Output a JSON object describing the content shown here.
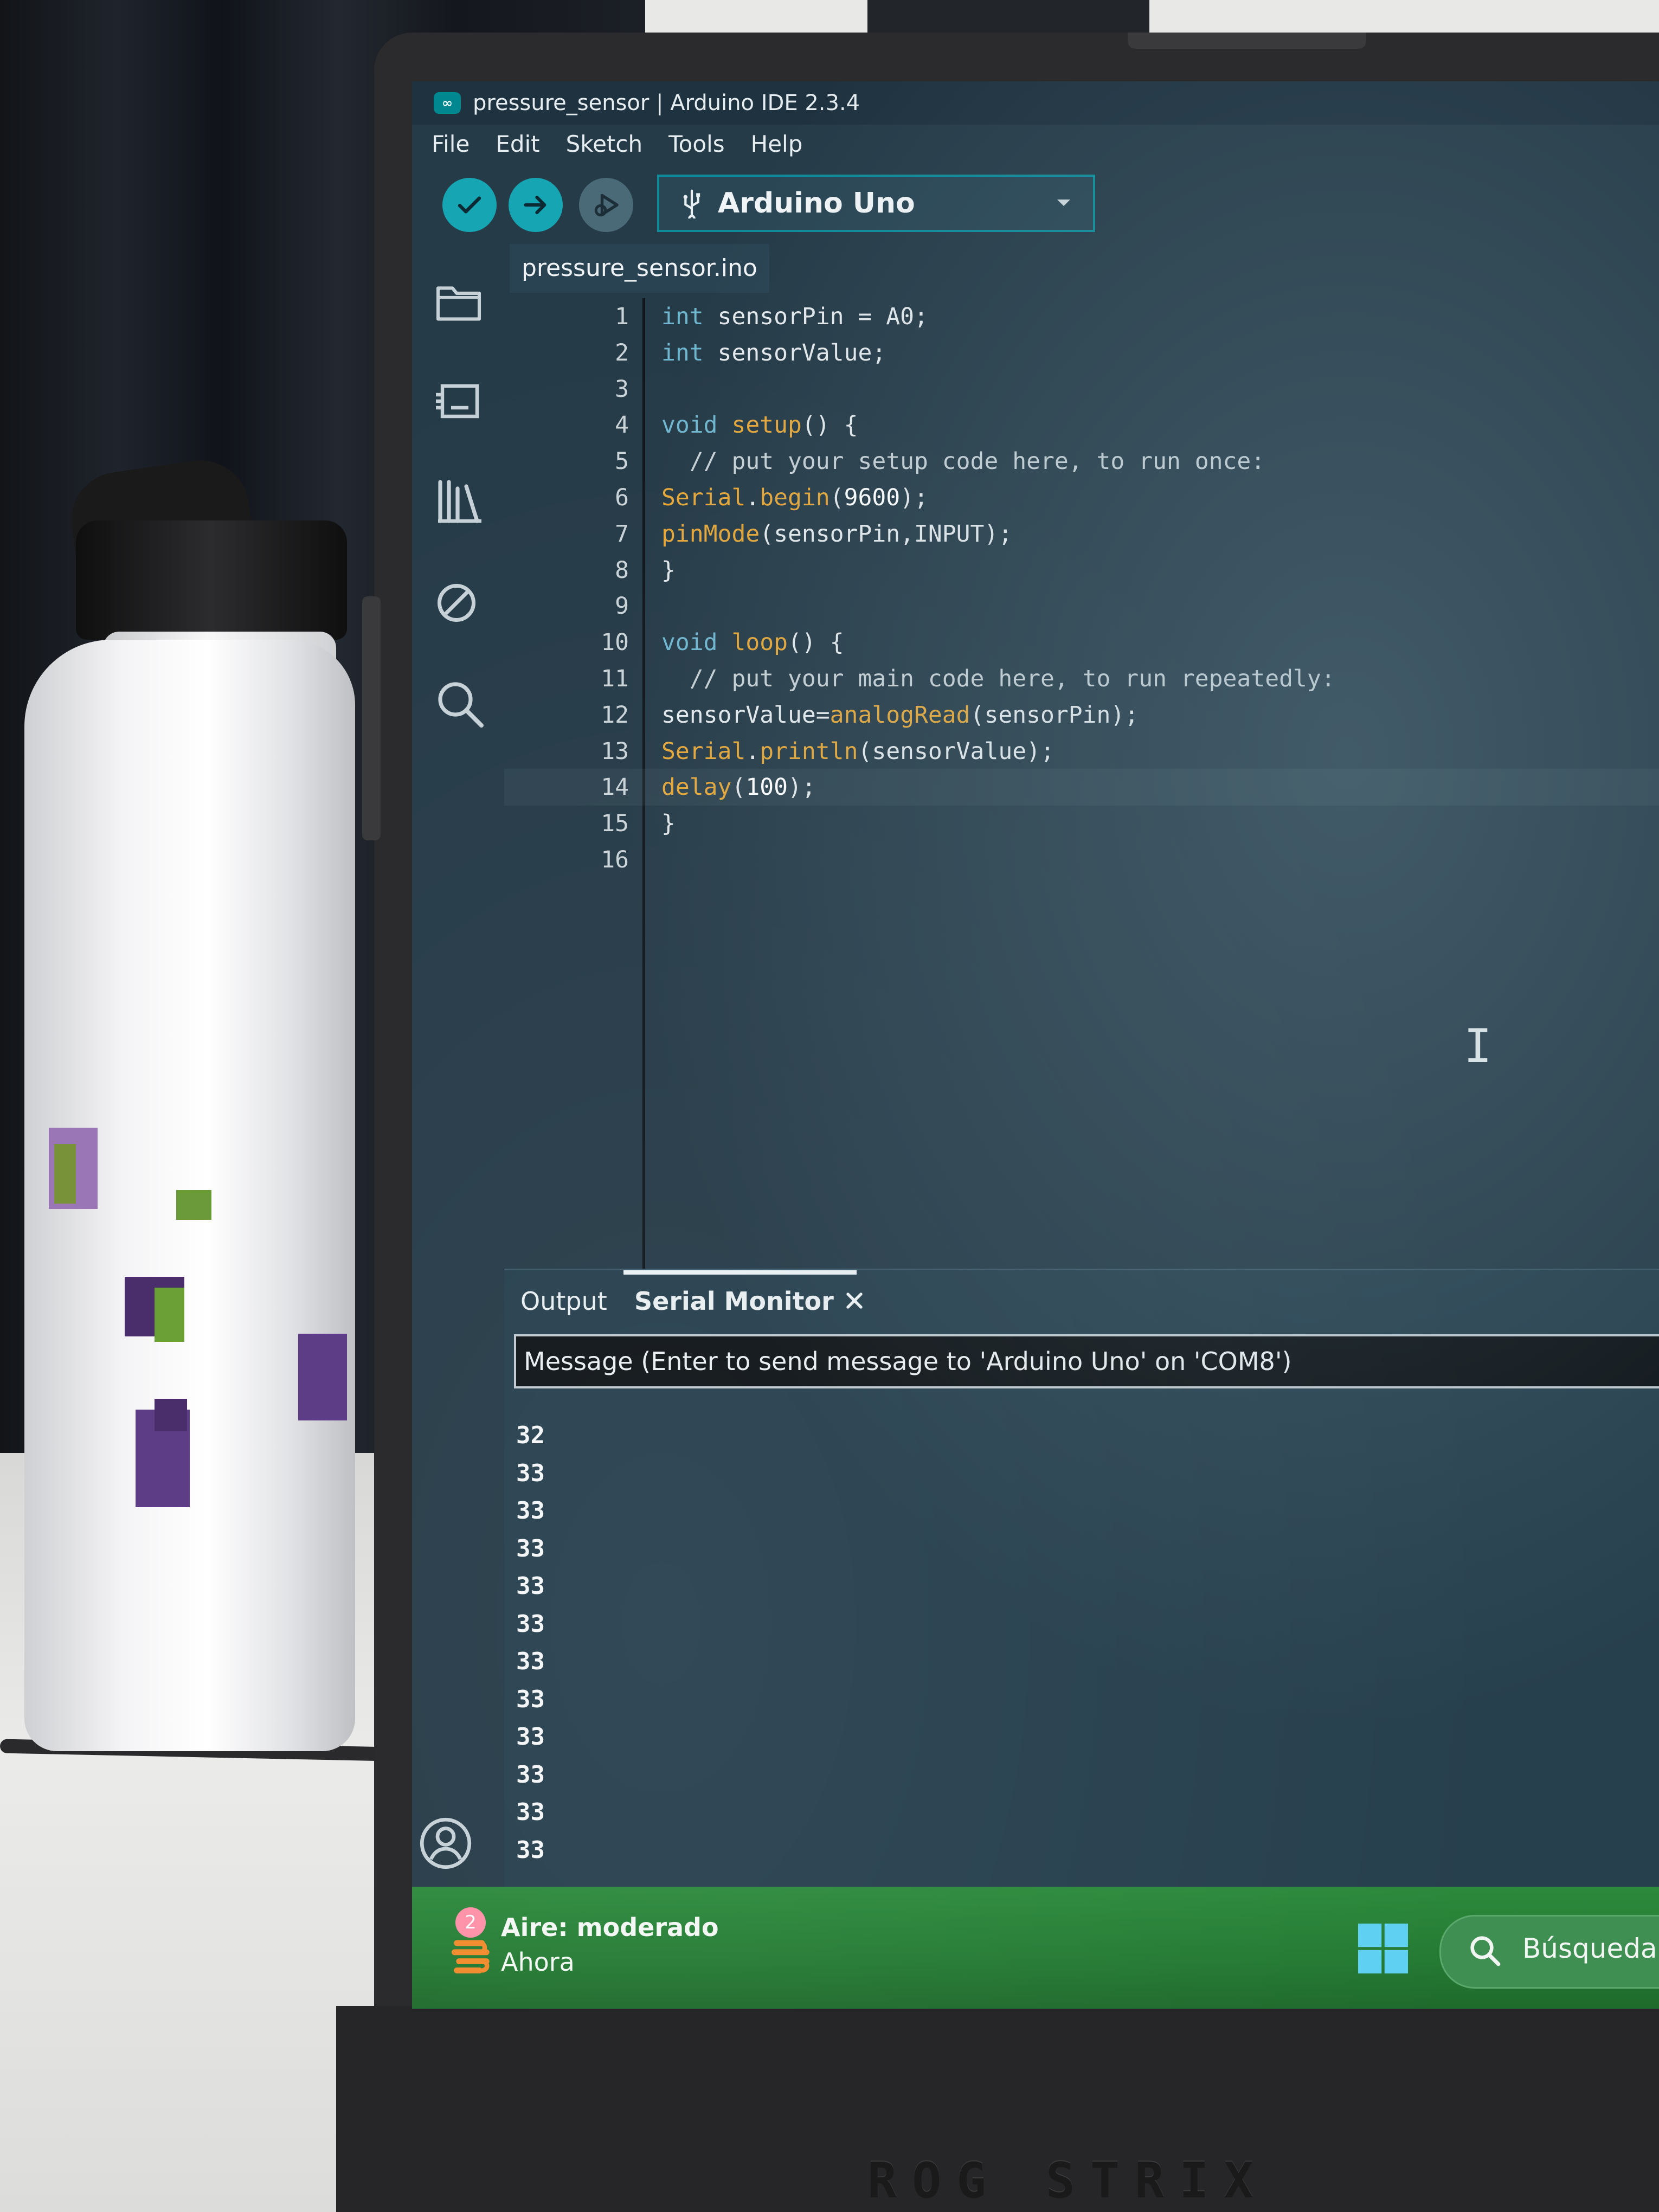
{
  "window": {
    "title": "pressure_sensor | Arduino IDE 2.3.4",
    "app_logo_glyph": "∞"
  },
  "menu": [
    "File",
    "Edit",
    "Sketch",
    "Tools",
    "Help"
  ],
  "toolbar": {
    "verify_icon": "checkmark-icon",
    "upload_icon": "arrow-right-icon",
    "debug_icon": "debug-play-icon",
    "board_label": "Arduino Uno",
    "board_icon": "usb-icon"
  },
  "sidebar": {
    "items": [
      "folder-icon",
      "board-manager-icon",
      "library-icon",
      "debug-icon",
      "search-icon"
    ],
    "bottom": "account-icon"
  },
  "editor": {
    "tab": "pressure_sensor.ino",
    "current_line": 14,
    "lines": [
      {
        "n": "1",
        "code": "int sensorPin = A0;"
      },
      {
        "n": "2",
        "code": "int sensorValue;"
      },
      {
        "n": "3",
        "code": ""
      },
      {
        "n": "4",
        "code": "void setup() {"
      },
      {
        "n": "5",
        "code": "  // put your setup code here, to run once:"
      },
      {
        "n": "6",
        "code": "Serial.begin(9600);"
      },
      {
        "n": "7",
        "code": "pinMode(sensorPin,INPUT);"
      },
      {
        "n": "8",
        "code": "}"
      },
      {
        "n": "9",
        "code": ""
      },
      {
        "n": "10",
        "code": "void loop() {"
      },
      {
        "n": "11",
        "code": "  // put your main code here, to run repeatedly:"
      },
      {
        "n": "12",
        "code": "sensorValue=analogRead(sensorPin);"
      },
      {
        "n": "13",
        "code": "Serial.println(sensorValue);"
      },
      {
        "n": "14",
        "code": "delay(100);"
      },
      {
        "n": "15",
        "code": "}"
      },
      {
        "n": "16",
        "code": ""
      }
    ]
  },
  "panel": {
    "tabs": [
      "Output",
      "Serial Monitor"
    ],
    "active_tab": "Serial Monitor",
    "close_icon": "close-icon",
    "input_placeholder": "Message (Enter to send message to 'Arduino Uno' on 'COM8')",
    "serial_output": [
      "32",
      "33",
      "33",
      "33",
      "33",
      "33",
      "33",
      "33",
      "33",
      "33",
      "33",
      "33"
    ]
  },
  "taskbar": {
    "weather_badge": "2",
    "weather_title": "Aire: moderado",
    "weather_sub": "Ahora",
    "search_label": "Búsqueda"
  },
  "device": {
    "brand": "ROG STRIX"
  },
  "colors": {
    "accent": "#16a5b3",
    "keyword": "#6fb6cf",
    "function": "#e5a73a",
    "taskbar": "#2c8a3c",
    "editor_bg": "#263b48"
  }
}
